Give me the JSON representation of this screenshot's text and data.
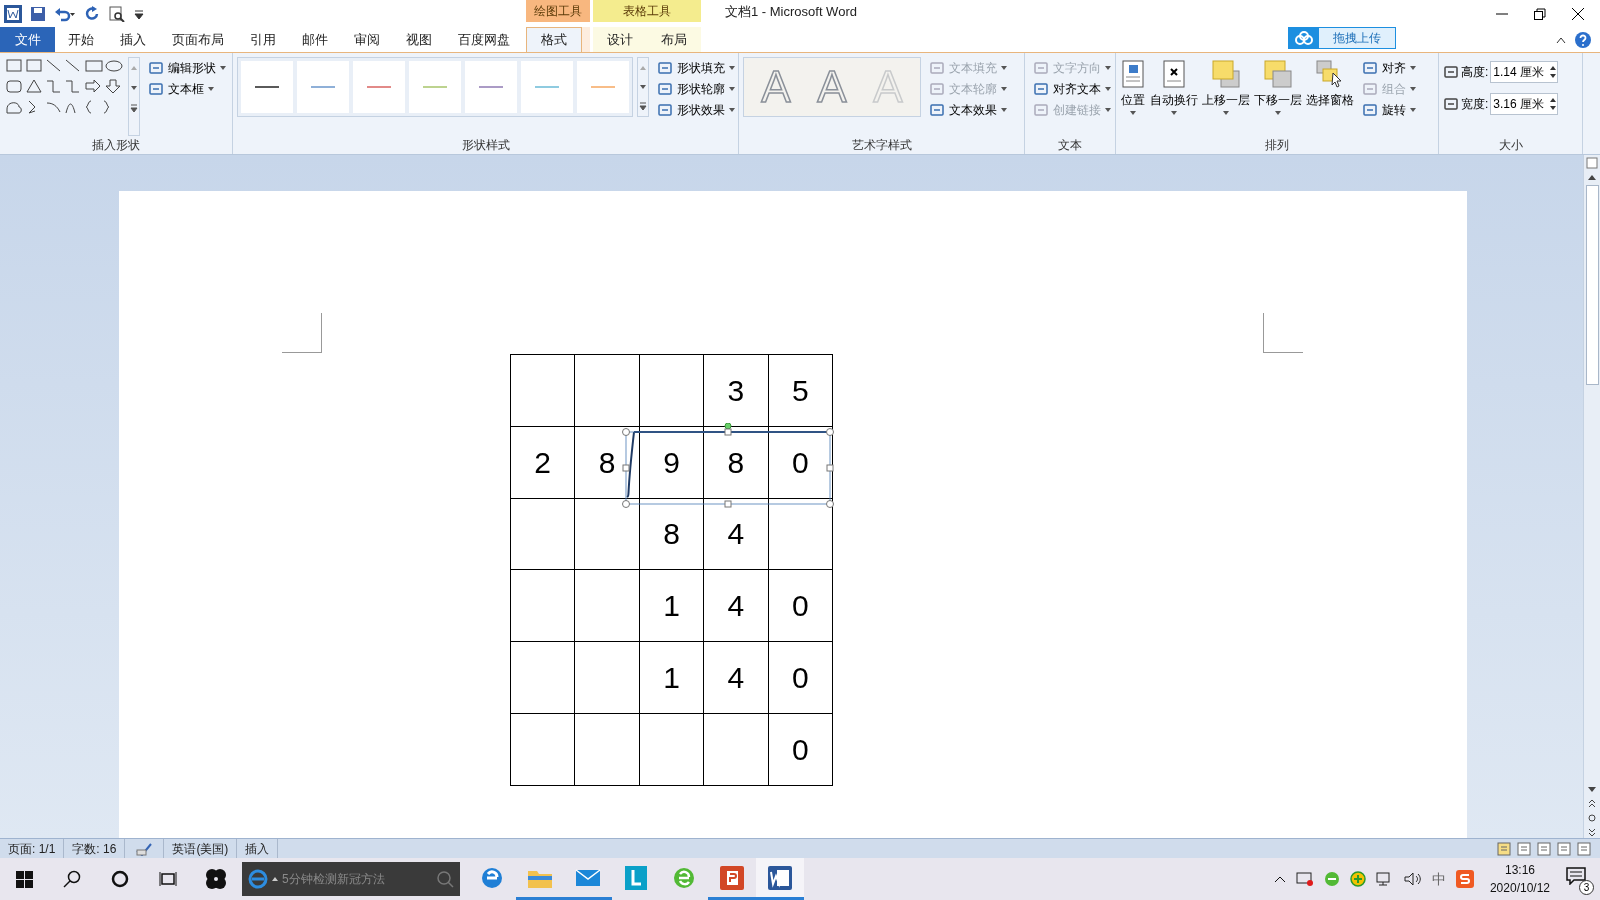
{
  "window": {
    "title": "文档1  -  Microsoft Word"
  },
  "context_tabs": [
    {
      "label": "绘图工具",
      "color": "#f8b77f",
      "tabs": [
        {
          "label": "格式",
          "selected": true
        }
      ]
    },
    {
      "label": "表格工具",
      "color": "#f4ec8e",
      "tabs": [
        {
          "label": "设计",
          "selected": false
        },
        {
          "label": "布局",
          "selected": false
        }
      ]
    }
  ],
  "tabs": [
    {
      "label": "文件",
      "kind": "file",
      "selected": false
    },
    {
      "label": "开始",
      "kind": "tab",
      "selected": false
    },
    {
      "label": "插入",
      "kind": "tab",
      "selected": false
    },
    {
      "label": "页面布局",
      "kind": "tab",
      "selected": false
    },
    {
      "label": "引用",
      "kind": "tab",
      "selected": false
    },
    {
      "label": "邮件",
      "kind": "tab",
      "selected": false
    },
    {
      "label": "审阅",
      "kind": "tab",
      "selected": false
    },
    {
      "label": "视图",
      "kind": "tab",
      "selected": false
    },
    {
      "label": "百度网盘",
      "kind": "tab",
      "selected": false
    }
  ],
  "upload_button": "拖拽上传",
  "ribbon": {
    "insert_shapes": {
      "label": "插入形状",
      "commands": [
        {
          "label": "编辑形状",
          "disabled": false
        },
        {
          "label": "文本框",
          "disabled": false
        }
      ]
    },
    "shape_styles": {
      "label": "形状样式",
      "swatches": [
        {
          "color": "#5a5a5a"
        },
        {
          "color": "#8fb0d8"
        },
        {
          "color": "#e28a88"
        },
        {
          "color": "#bdd38f"
        },
        {
          "color": "#ab9bc6"
        },
        {
          "color": "#8fcbe0"
        },
        {
          "color": "#f8bd88"
        }
      ],
      "commands": [
        {
          "label": "形状填充",
          "disabled": false
        },
        {
          "label": "形状轮廓",
          "disabled": false
        },
        {
          "label": "形状效果",
          "disabled": false
        }
      ]
    },
    "wordart_styles": {
      "label": "艺术字样式",
      "samples": [
        {
          "label": "A"
        },
        {
          "label": "A"
        },
        {
          "label": "A"
        }
      ],
      "commands": [
        {
          "label": "文本填充",
          "disabled": true
        },
        {
          "label": "文本轮廓",
          "disabled": true
        },
        {
          "label": "文本效果",
          "disabled": false
        }
      ]
    },
    "text": {
      "label": "文本",
      "commands": [
        {
          "label": "文字方向",
          "disabled": true
        },
        {
          "label": "对齐文本",
          "disabled": false
        },
        {
          "label": "创建链接",
          "disabled": true
        }
      ]
    },
    "arrange": {
      "label": "排列",
      "large": [
        {
          "label": "位置",
          "kind": "position"
        },
        {
          "label": "自动换行",
          "kind": "wrap"
        },
        {
          "label": "上移一层",
          "kind": "forward"
        },
        {
          "label": "下移一层",
          "kind": "backward"
        },
        {
          "label": "选择窗格",
          "kind": "pane"
        }
      ],
      "commands": [
        {
          "label": "对齐",
          "disabled": false
        },
        {
          "label": "组合",
          "disabled": true
        },
        {
          "label": "旋转",
          "disabled": false
        }
      ]
    },
    "size": {
      "label": "大小",
      "fields": [
        {
          "label": "高度:",
          "value": "1.14 厘米"
        },
        {
          "label": "宽度:",
          "value": "3.16 厘米"
        }
      ]
    }
  },
  "document": {
    "shape_selected": true,
    "table": {
      "rows": [
        {
          "cells": [
            {},
            {},
            {},
            {
              "text": "3"
            },
            {
              "text": "5"
            }
          ]
        },
        {
          "cells": [
            {
              "text": "2"
            },
            {
              "text": "8"
            },
            {
              "text": "9"
            },
            {
              "text": "8"
            },
            {
              "text": "0"
            }
          ]
        },
        {
          "cells": [
            {},
            {},
            {
              "text": "8"
            },
            {
              "text": "4"
            },
            {}
          ]
        },
        {
          "cells": [
            {},
            {},
            {
              "text": "1"
            },
            {
              "text": "4"
            },
            {
              "text": "0"
            }
          ]
        },
        {
          "cells": [
            {},
            {},
            {
              "text": "1"
            },
            {
              "text": "4"
            },
            {
              "text": "0"
            }
          ]
        },
        {
          "cells": [
            {},
            {},
            {},
            {},
            {
              "text": "0"
            }
          ]
        }
      ]
    }
  },
  "status_bar": [
    {
      "text": "页面: 1/1"
    },
    {
      "text": "字数: 16"
    },
    {
      "kind": "proof"
    },
    {
      "text": "英语(美国)"
    },
    {
      "text": "插入"
    }
  ],
  "taskbar": {
    "search_placeholder": "5分钟检测新冠方法",
    "apps": [
      {
        "kind": "edge",
        "open": false
      },
      {
        "kind": "folder",
        "open": true
      },
      {
        "kind": "mail",
        "open": true
      },
      {
        "kind": "l",
        "open": false
      },
      {
        "kind": "ie",
        "open": false
      },
      {
        "kind": "ppt",
        "open": true
      },
      {
        "kind": "word",
        "open": true
      }
    ],
    "ime": "中",
    "time": "13:16",
    "date": "2020/10/12",
    "notifications": "3"
  }
}
